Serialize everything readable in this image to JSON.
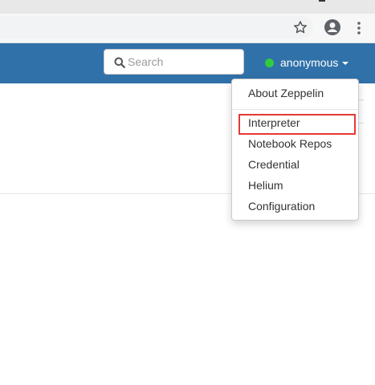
{
  "browser": {
    "star_icon": "star-icon",
    "account_icon": "account-circle-icon",
    "menu_icon": "kebab-menu-icon"
  },
  "navbar": {
    "search_placeholder": "Search",
    "search_icon": "search-icon",
    "user_name": "anonymous",
    "status_color": "#2ecc40",
    "bg_color": "#3071a9"
  },
  "dropdown": {
    "items": [
      {
        "label": "About Zeppelin"
      },
      {
        "label": "Interpreter",
        "highlighted": true
      },
      {
        "label": "Notebook Repos"
      },
      {
        "label": "Credential"
      },
      {
        "label": "Helium"
      },
      {
        "label": "Configuration"
      }
    ],
    "highlight_color": "#e53935"
  }
}
